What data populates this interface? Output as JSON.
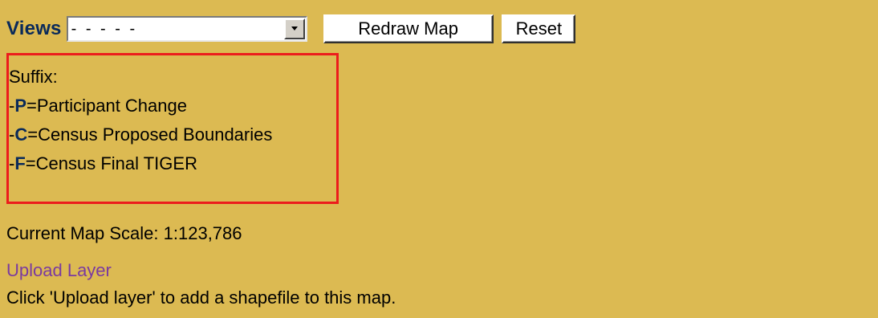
{
  "toolbar": {
    "views_label": "Views",
    "views_select_value": "- - - - -",
    "redraw_label": "Redraw Map",
    "reset_label": "Reset"
  },
  "suffix": {
    "title": "Suffix:",
    "items": [
      {
        "prefix": "-",
        "code": "P",
        "text": "=Participant Change"
      },
      {
        "prefix": "-",
        "code": "C",
        "text": "=Census Proposed Boundaries"
      },
      {
        "prefix": "-",
        "code": "F",
        "text": "=Census Final TIGER"
      }
    ]
  },
  "scale_text": "Current Map Scale: 1:123,786",
  "upload": {
    "link_label": "Upload Layer",
    "help_text": "Click 'Upload layer' to add a shapefile to this map."
  },
  "colors": {
    "background": "#dcba52",
    "label_blue": "#0a2a5a",
    "box_border": "#ec1c1c",
    "link_visited": "#7a3aa0"
  }
}
